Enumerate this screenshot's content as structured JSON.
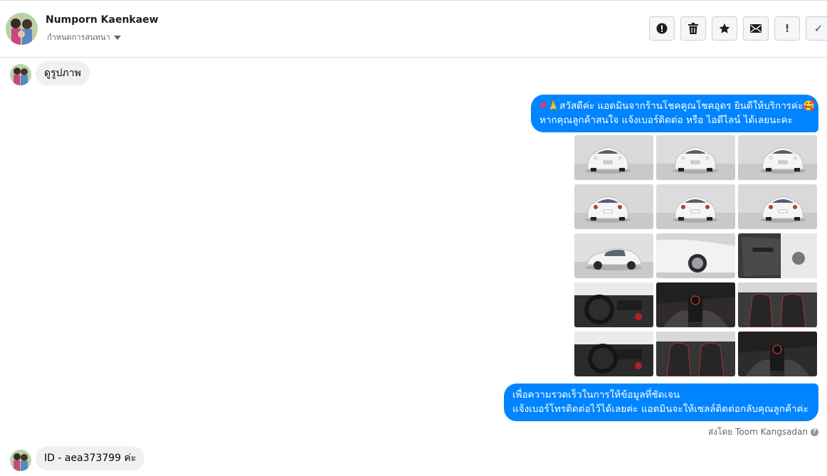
{
  "header": {
    "name": "Numporn Kaenkaew",
    "subtitle": "กำหนดการสนทนา"
  },
  "toolbar": [
    {
      "id": "spam",
      "icon": "alert-circle-icon"
    },
    {
      "id": "delete",
      "icon": "trash-icon"
    },
    {
      "id": "star",
      "icon": "star-icon"
    },
    {
      "id": "mark-unread",
      "icon": "envelope-icon",
      "glyph": ""
    },
    {
      "id": "important",
      "icon": "exclamation-icon",
      "glyph": "!"
    },
    {
      "id": "done",
      "icon": "check-icon",
      "glyph": "✓"
    }
  ],
  "messages": {
    "incoming_1": "ดูรูปภาพ",
    "outgoing_1": {
      "line1": "สวัสดีค่ะ แอดมินจากร้านโชคคูณโชคอุดร ยินดีให้บริการค่ะ",
      "line2": "หากคุณลูกค้าสนใจ แจ้งเบอร์ติดต่อ หรือ ไอดีไลน์ ได้เลยนะคะ",
      "emoji_start": [
        "❤",
        "🙏"
      ],
      "emoji_end": "🥰"
    },
    "photos": [
      {
        "kind": "front-left",
        "bg": "#d9d9d9"
      },
      {
        "kind": "front",
        "bg": "#dcdcdc"
      },
      {
        "kind": "front-right",
        "bg": "#dadada"
      },
      {
        "kind": "rear-left",
        "bg": "#d8d8d8"
      },
      {
        "kind": "rear",
        "bg": "#dcdcdc"
      },
      {
        "kind": "rear-right",
        "bg": "#d9d9d9"
      },
      {
        "kind": "side",
        "bg": "#e0e0e0"
      },
      {
        "kind": "wheel",
        "bg": "#d5d5d5"
      },
      {
        "kind": "door-panel",
        "bg": "#3a3a3a"
      },
      {
        "kind": "dashboard",
        "bg": "#2e2e2e"
      },
      {
        "kind": "gear",
        "bg": "#302a2a"
      },
      {
        "kind": "seats",
        "bg": "#3b3b3b"
      },
      {
        "kind": "steering",
        "bg": "#2a2a2a"
      },
      {
        "kind": "rear-seats",
        "bg": "#353535"
      },
      {
        "kind": "console",
        "bg": "#2c2c2c"
      }
    ],
    "outgoing_2": {
      "line1": "เพื่อความรวดเร็วในการให้ข้อมูลที่ชัดเจน",
      "line2": "แจ้งเบอร์โทรติดต่อไว้ได้เลยค่ะ แอดมินจะให้เซลล์ติดต่อกลับคุณลูกค้าค่ะ"
    },
    "sent_by": "ส่งโดย Toom Kangsadan",
    "incoming_2": "ID - aea373799 ค่ะ"
  }
}
